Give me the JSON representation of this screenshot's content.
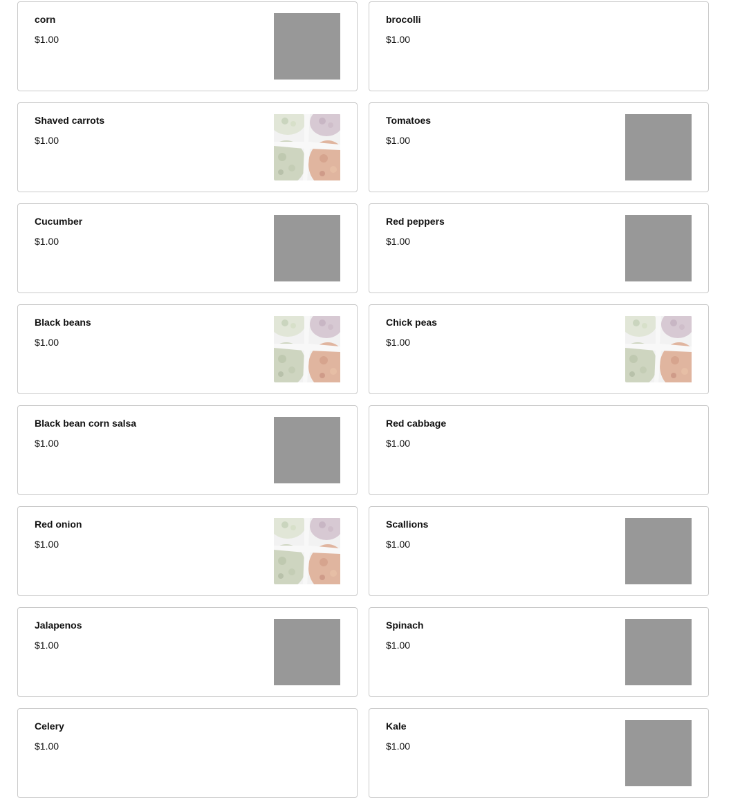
{
  "items": [
    {
      "name": "corn",
      "price": "$1.00",
      "image": "placeholder"
    },
    {
      "name": "brocolli",
      "price": "$1.00",
      "image": "none"
    },
    {
      "name": "Shaved carrots",
      "price": "$1.00",
      "image": "photo"
    },
    {
      "name": "Tomatoes",
      "price": "$1.00",
      "image": "placeholder"
    },
    {
      "name": "Cucumber",
      "price": "$1.00",
      "image": "placeholder"
    },
    {
      "name": "Red peppers",
      "price": "$1.00",
      "image": "placeholder"
    },
    {
      "name": "Black beans",
      "price": "$1.00",
      "image": "photo"
    },
    {
      "name": "Chick peas",
      "price": "$1.00",
      "image": "photo"
    },
    {
      "name": "Black bean corn salsa",
      "price": "$1.00",
      "image": "placeholder"
    },
    {
      "name": "Red cabbage",
      "price": "$1.00",
      "image": "none"
    },
    {
      "name": "Red onion",
      "price": "$1.00",
      "image": "photo"
    },
    {
      "name": "Scallions",
      "price": "$1.00",
      "image": "placeholder"
    },
    {
      "name": "Jalapenos",
      "price": "$1.00",
      "image": "placeholder"
    },
    {
      "name": "Spinach",
      "price": "$1.00",
      "image": "placeholder"
    },
    {
      "name": "Celery",
      "price": "$1.00",
      "image": "none"
    },
    {
      "name": "Kale",
      "price": "$1.00",
      "image": "placeholder"
    }
  ],
  "colors": {
    "placeholder": "#989898",
    "border": "#c9c9c9"
  }
}
